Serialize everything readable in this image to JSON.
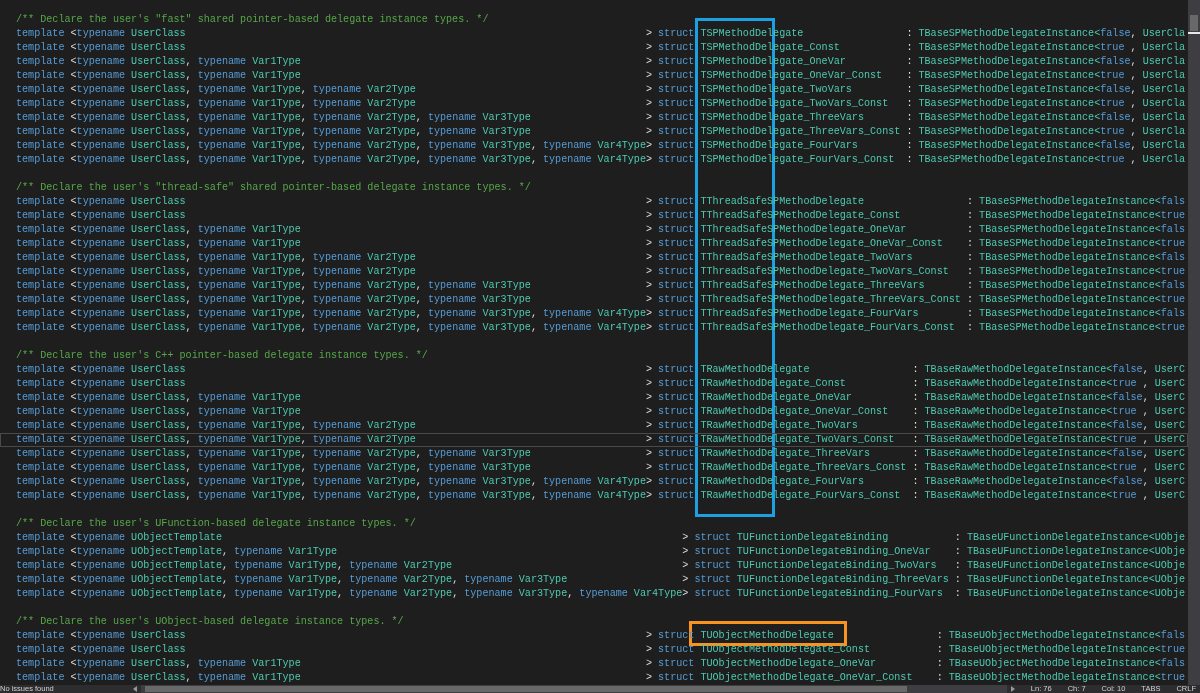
{
  "editor": {
    "sections": [
      {
        "comment": "/** Declare the user's \"fast\" shared pointer-based delegate instance types. */",
        "lines": [
          {
            "current": false,
            "keyword": "template",
            "params": [
              {
                "punct": "<",
                "keyword": "typename",
                "type": "UserClass"
              }
            ],
            "close": ">",
            "struct": "struct",
            "name": "TSPMethodDelegate",
            "colon": ":",
            "base": "TBaseSPMethodDelegateInstance<",
            "flag": "false",
            "comma": ",",
            "rest": "UserCla"
          },
          {
            "current": false,
            "keyword": "template",
            "params": [
              {
                "punct": "<",
                "keyword": "typename",
                "type": "UserClass"
              }
            ],
            "close": ">",
            "struct": "struct",
            "name": "TSPMethodDelegate_Const",
            "colon": ":",
            "base": "TBaseSPMethodDelegateInstance<",
            "flag": "true",
            "comma": ",",
            "rest": "UserCla"
          },
          {
            "current": false,
            "keyword": "template",
            "params": [
              {
                "punct": "<",
                "keyword": "typename",
                "type": "UserClass"
              },
              {
                "punct": ",",
                "keyword": "typename",
                "type": "Var1Type"
              }
            ],
            "close": ">",
            "struct": "struct",
            "name": "TSPMethodDelegate_OneVar",
            "colon": ":",
            "base": "TBaseSPMethodDelegateInstance<",
            "flag": "false",
            "comma": ",",
            "rest": "UserCla"
          },
          {
            "current": false,
            "keyword": "template",
            "params": [
              {
                "punct": "<",
                "keyword": "typename",
                "type": "UserClass"
              },
              {
                "punct": ",",
                "keyword": "typename",
                "type": "Var1Type"
              }
            ],
            "close": ">",
            "struct": "struct",
            "name": "TSPMethodDelegate_OneVar_Const",
            "colon": ":",
            "base": "TBaseSPMethodDelegateInstance<",
            "flag": "true",
            "comma": ",",
            "rest": "UserCla"
          },
          {
            "current": false,
            "keyword": "template",
            "params": [
              {
                "punct": "<",
                "keyword": "typename",
                "type": "UserClass"
              },
              {
                "punct": ",",
                "keyword": "typename",
                "type": "Var1Type"
              },
              {
                "punct": ",",
                "keyword": "typename",
                "type": "Var2Type"
              }
            ],
            "close": ">",
            "struct": "struct",
            "name": "TSPMethodDelegate_TwoVars",
            "colon": ":",
            "base": "TBaseSPMethodDelegateInstance<",
            "flag": "false",
            "comma": ",",
            "rest": "UserCla"
          },
          {
            "current": false,
            "keyword": "template",
            "params": [
              {
                "punct": "<",
                "keyword": "typename",
                "type": "UserClass"
              },
              {
                "punct": ",",
                "keyword": "typename",
                "type": "Var1Type"
              },
              {
                "punct": ",",
                "keyword": "typename",
                "type": "Var2Type"
              }
            ],
            "close": ">",
            "struct": "struct",
            "name": "TSPMethodDelegate_TwoVars_Const",
            "colon": ":",
            "base": "TBaseSPMethodDelegateInstance<",
            "flag": "true",
            "comma": ",",
            "rest": "UserCla"
          },
          {
            "current": false,
            "keyword": "template",
            "params": [
              {
                "punct": "<",
                "keyword": "typename",
                "type": "UserClass"
              },
              {
                "punct": ",",
                "keyword": "typename",
                "type": "Var1Type"
              },
              {
                "punct": ",",
                "keyword": "typename",
                "type": "Var2Type"
              },
              {
                "punct": ",",
                "keyword": "typename",
                "type": "Var3Type"
              }
            ],
            "close": ">",
            "struct": "struct",
            "name": "TSPMethodDelegate_ThreeVars",
            "colon": ":",
            "base": "TBaseSPMethodDelegateInstance<",
            "flag": "false",
            "comma": ",",
            "rest": "UserCla"
          },
          {
            "current": false,
            "keyword": "template",
            "params": [
              {
                "punct": "<",
                "keyword": "typename",
                "type": "UserClass"
              },
              {
                "punct": ",",
                "keyword": "typename",
                "type": "Var1Type"
              },
              {
                "punct": ",",
                "keyword": "typename",
                "type": "Var2Type"
              },
              {
                "punct": ",",
                "keyword": "typename",
                "type": "Var3Type"
              }
            ],
            "close": ">",
            "struct": "struct",
            "name": "TSPMethodDelegate_ThreeVars_Const",
            "colon": ":",
            "base": "TBaseSPMethodDelegateInstance<",
            "flag": "true",
            "comma": ",",
            "rest": "UserCla"
          },
          {
            "current": false,
            "keyword": "template",
            "params": [
              {
                "punct": "<",
                "keyword": "typename",
                "type": "UserClass"
              },
              {
                "punct": ",",
                "keyword": "typename",
                "type": "Var1Type"
              },
              {
                "punct": ",",
                "keyword": "typename",
                "type": "Var2Type"
              },
              {
                "punct": ",",
                "keyword": "typename",
                "type": "Var3Type"
              },
              {
                "punct": ",",
                "keyword": "typename",
                "type": "Var4Type"
              }
            ],
            "close": ">",
            "struct": "struct",
            "name": "TSPMethodDelegate_FourVars",
            "colon": ":",
            "base": "TBaseSPMethodDelegateInstance<",
            "flag": "false",
            "comma": ",",
            "rest": "UserCla"
          },
          {
            "current": false,
            "keyword": "template",
            "params": [
              {
                "punct": "<",
                "keyword": "typename",
                "type": "UserClass"
              },
              {
                "punct": ",",
                "keyword": "typename",
                "type": "Var1Type"
              },
              {
                "punct": ",",
                "keyword": "typename",
                "type": "Var2Type"
              },
              {
                "punct": ",",
                "keyword": "typename",
                "type": "Var3Type"
              },
              {
                "punct": ",",
                "keyword": "typename",
                "type": "Var4Type"
              }
            ],
            "close": ">",
            "struct": "struct",
            "name": "TSPMethodDelegate_FourVars_Const",
            "colon": ":",
            "base": "TBaseSPMethodDelegateInstance<",
            "flag": "true",
            "comma": ",",
            "rest": "UserCla"
          }
        ]
      },
      {
        "comment": "/** Declare the user's \"thread-safe\" shared pointer-based delegate instance types. */",
        "lines": [
          {
            "current": false,
            "keyword": "template",
            "params": [
              {
                "punct": "<",
                "keyword": "typename",
                "type": "UserClass"
              }
            ],
            "close": ">",
            "struct": "struct",
            "name": "TThreadSafeSPMethodDelegate",
            "colon": ":",
            "base": "TBaseSPMethodDelegateInstance<",
            "flag": "fals"
          },
          {
            "current": false,
            "keyword": "template",
            "params": [
              {
                "punct": "<",
                "keyword": "typename",
                "type": "UserClass"
              }
            ],
            "close": ">",
            "struct": "struct",
            "name": "TThreadSafeSPMethodDelegate_Const",
            "colon": ":",
            "base": "TBaseSPMethodDelegateInstance<",
            "flag": "true"
          },
          {
            "current": false,
            "keyword": "template",
            "params": [
              {
                "punct": "<",
                "keyword": "typename",
                "type": "UserClass"
              },
              {
                "punct": ",",
                "keyword": "typename",
                "type": "Var1Type"
              }
            ],
            "close": ">",
            "struct": "struct",
            "name": "TThreadSafeSPMethodDelegate_OneVar",
            "colon": ":",
            "base": "TBaseSPMethodDelegateInstance<",
            "flag": "fals"
          },
          {
            "current": false,
            "keyword": "template",
            "params": [
              {
                "punct": "<",
                "keyword": "typename",
                "type": "UserClass"
              },
              {
                "punct": ",",
                "keyword": "typename",
                "type": "Var1Type"
              }
            ],
            "close": ">",
            "struct": "struct",
            "name": "TThreadSafeSPMethodDelegate_OneVar_Const",
            "colon": ":",
            "base": "TBaseSPMethodDelegateInstance<",
            "flag": "true"
          },
          {
            "current": false,
            "keyword": "template",
            "params": [
              {
                "punct": "<",
                "keyword": "typename",
                "type": "UserClass"
              },
              {
                "punct": ",",
                "keyword": "typename",
                "type": "Var1Type"
              },
              {
                "punct": ",",
                "keyword": "typename",
                "type": "Var2Type"
              }
            ],
            "close": ">",
            "struct": "struct",
            "name": "TThreadSafeSPMethodDelegate_TwoVars",
            "colon": ":",
            "base": "TBaseSPMethodDelegateInstance<",
            "flag": "fals"
          },
          {
            "current": false,
            "keyword": "template",
            "params": [
              {
                "punct": "<",
                "keyword": "typename",
                "type": "UserClass"
              },
              {
                "punct": ",",
                "keyword": "typename",
                "type": "Var1Type"
              },
              {
                "punct": ",",
                "keyword": "typename",
                "type": "Var2Type"
              }
            ],
            "close": ">",
            "struct": "struct",
            "name": "TThreadSafeSPMethodDelegate_TwoVars_Const",
            "colon": ":",
            "base": "TBaseSPMethodDelegateInstance<",
            "flag": "true"
          },
          {
            "current": false,
            "keyword": "template",
            "params": [
              {
                "punct": "<",
                "keyword": "typename",
                "type": "UserClass"
              },
              {
                "punct": ",",
                "keyword": "typename",
                "type": "Var1Type"
              },
              {
                "punct": ",",
                "keyword": "typename",
                "type": "Var2Type"
              },
              {
                "punct": ",",
                "keyword": "typename",
                "type": "Var3Type"
              }
            ],
            "close": ">",
            "struct": "struct",
            "name": "TThreadSafeSPMethodDelegate_ThreeVars",
            "colon": ":",
            "base": "TBaseSPMethodDelegateInstance<",
            "flag": "fals"
          },
          {
            "current": false,
            "keyword": "template",
            "params": [
              {
                "punct": "<",
                "keyword": "typename",
                "type": "UserClass"
              },
              {
                "punct": ",",
                "keyword": "typename",
                "type": "Var1Type"
              },
              {
                "punct": ",",
                "keyword": "typename",
                "type": "Var2Type"
              },
              {
                "punct": ",",
                "keyword": "typename",
                "type": "Var3Type"
              }
            ],
            "close": ">",
            "struct": "struct",
            "name": "TThreadSafeSPMethodDelegate_ThreeVars_Const",
            "colon": ":",
            "base": "TBaseSPMethodDelegateInstance<",
            "flag": "true"
          },
          {
            "current": false,
            "keyword": "template",
            "params": [
              {
                "punct": "<",
                "keyword": "typename",
                "type": "UserClass"
              },
              {
                "punct": ",",
                "keyword": "typename",
                "type": "Var1Type"
              },
              {
                "punct": ",",
                "keyword": "typename",
                "type": "Var2Type"
              },
              {
                "punct": ",",
                "keyword": "typename",
                "type": "Var3Type"
              },
              {
                "punct": ",",
                "keyword": "typename",
                "type": "Var4Type"
              }
            ],
            "close": ">",
            "struct": "struct",
            "name": "TThreadSafeSPMethodDelegate_FourVars",
            "colon": ":",
            "base": "TBaseSPMethodDelegateInstance<",
            "flag": "fals"
          },
          {
            "current": false,
            "keyword": "template",
            "params": [
              {
                "punct": "<",
                "keyword": "typename",
                "type": "UserClass"
              },
              {
                "punct": ",",
                "keyword": "typename",
                "type": "Var1Type"
              },
              {
                "punct": ",",
                "keyword": "typename",
                "type": "Var2Type"
              },
              {
                "punct": ",",
                "keyword": "typename",
                "type": "Var3Type"
              },
              {
                "punct": ",",
                "keyword": "typename",
                "type": "Var4Type"
              }
            ],
            "close": ">",
            "struct": "struct",
            "name": "TThreadSafeSPMethodDelegate_FourVars_Const",
            "colon": ":",
            "base": "TBaseSPMethodDelegateInstance<",
            "flag": "true"
          }
        ]
      },
      {
        "comment": "/** Declare the user's C++ pointer-based delegate instance types. */",
        "lines": [
          {
            "current": false,
            "keyword": "template",
            "params": [
              {
                "punct": "<",
                "keyword": "typename",
                "type": "UserClass"
              }
            ],
            "close": ">",
            "struct": "struct",
            "name": "TRawMethodDelegate",
            "colon": ":",
            "base": "TBaseRawMethodDelegateInstance<",
            "flag": "false",
            "comma": ",",
            "rest": "UserC"
          },
          {
            "current": false,
            "keyword": "template",
            "params": [
              {
                "punct": "<",
                "keyword": "typename",
                "type": "UserClass"
              }
            ],
            "close": ">",
            "struct": "struct",
            "name": "TRawMethodDelegate_Const",
            "colon": ":",
            "base": "TBaseRawMethodDelegateInstance<",
            "flag": "true",
            "comma": ",",
            "rest": "UserC"
          },
          {
            "current": false,
            "keyword": "template",
            "params": [
              {
                "punct": "<",
                "keyword": "typename",
                "type": "UserClass"
              },
              {
                "punct": ",",
                "keyword": "typename",
                "type": "Var1Type"
              }
            ],
            "close": ">",
            "struct": "struct",
            "name": "TRawMethodDelegate_OneVar",
            "colon": ":",
            "base": "TBaseRawMethodDelegateInstance<",
            "flag": "false",
            "comma": ",",
            "rest": "UserC"
          },
          {
            "current": false,
            "keyword": "template",
            "params": [
              {
                "punct": "<",
                "keyword": "typename",
                "type": "UserClass"
              },
              {
                "punct": ",",
                "keyword": "typename",
                "type": "Var1Type"
              }
            ],
            "close": ">",
            "struct": "struct",
            "name": "TRawMethodDelegate_OneVar_Const",
            "colon": ":",
            "base": "TBaseRawMethodDelegateInstance<",
            "flag": "true",
            "comma": ",",
            "rest": "UserC"
          },
          {
            "current": false,
            "keyword": "template",
            "params": [
              {
                "punct": "<",
                "keyword": "typename",
                "type": "UserClass"
              },
              {
                "punct": ",",
                "keyword": "typename",
                "type": "Var1Type"
              },
              {
                "punct": ",",
                "keyword": "typename",
                "type": "Var2Type"
              }
            ],
            "close": ">",
            "struct": "struct",
            "name": "TRawMethodDelegate_TwoVars",
            "colon": ":",
            "base": "TBaseRawMethodDelegateInstance<",
            "flag": "false",
            "comma": ",",
            "rest": "UserC"
          },
          {
            "current": true,
            "keyword": "template",
            "params": [
              {
                "punct": "<",
                "keyword": "typename",
                "type": "UserClass"
              },
              {
                "punct": ",",
                "keyword": "typename",
                "type": "Var1Type"
              },
              {
                "punct": ",",
                "keyword": "typename",
                "type": "Var2Type"
              }
            ],
            "close": ">",
            "struct": "struct",
            "name": "TRawMethodDelegate_TwoVars_Const",
            "colon": ":",
            "base": "TBaseRawMethodDelegateInstance<",
            "flag": "true",
            "comma": ",",
            "rest": "UserC"
          },
          {
            "current": false,
            "keyword": "template",
            "params": [
              {
                "punct": "<",
                "keyword": "typename",
                "type": "UserClass"
              },
              {
                "punct": ",",
                "keyword": "typename",
                "type": "Var1Type"
              },
              {
                "punct": ",",
                "keyword": "typename",
                "type": "Var2Type"
              },
              {
                "punct": ",",
                "keyword": "typename",
                "type": "Var3Type"
              }
            ],
            "close": ">",
            "struct": "struct",
            "name": "TRawMethodDelegate_ThreeVars",
            "colon": ":",
            "base": "TBaseRawMethodDelegateInstance<",
            "flag": "false",
            "comma": ",",
            "rest": "UserC"
          },
          {
            "current": false,
            "keyword": "template",
            "params": [
              {
                "punct": "<",
                "keyword": "typename",
                "type": "UserClass"
              },
              {
                "punct": ",",
                "keyword": "typename",
                "type": "Var1Type"
              },
              {
                "punct": ",",
                "keyword": "typename",
                "type": "Var2Type"
              },
              {
                "punct": ",",
                "keyword": "typename",
                "type": "Var3Type"
              }
            ],
            "close": ">",
            "struct": "struct",
            "name": "TRawMethodDelegate_ThreeVars_Const",
            "colon": ":",
            "base": "TBaseRawMethodDelegateInstance<",
            "flag": "true",
            "comma": ",",
            "rest": "UserC"
          },
          {
            "current": false,
            "keyword": "template",
            "params": [
              {
                "punct": "<",
                "keyword": "typename",
                "type": "UserClass"
              },
              {
                "punct": ",",
                "keyword": "typename",
                "type": "Var1Type"
              },
              {
                "punct": ",",
                "keyword": "typename",
                "type": "Var2Type"
              },
              {
                "punct": ",",
                "keyword": "typename",
                "type": "Var3Type"
              },
              {
                "punct": ",",
                "keyword": "typename",
                "type": "Var4Type"
              }
            ],
            "close": ">",
            "struct": "struct",
            "name": "TRawMethodDelegate_FourVars",
            "colon": ":",
            "base": "TBaseRawMethodDelegateInstance<",
            "flag": "false",
            "comma": ",",
            "rest": "UserC"
          },
          {
            "current": false,
            "keyword": "template",
            "params": [
              {
                "punct": "<",
                "keyword": "typename",
                "type": "UserClass"
              },
              {
                "punct": ",",
                "keyword": "typename",
                "type": "Var1Type"
              },
              {
                "punct": ",",
                "keyword": "typename",
                "type": "Var2Type"
              },
              {
                "punct": ",",
                "keyword": "typename",
                "type": "Var3Type"
              },
              {
                "punct": ",",
                "keyword": "typename",
                "type": "Var4Type"
              }
            ],
            "close": ">",
            "struct": "struct",
            "name": "TRawMethodDelegate_FourVars_Const",
            "colon": ":",
            "base": "TBaseRawMethodDelegateInstance<",
            "flag": "true",
            "comma": ",",
            "rest": "UserC"
          }
        ]
      },
      {
        "comment": "/** Declare the user's UFunction-based delegate instance types. */",
        "lines": [
          {
            "current": false,
            "keyword": "template",
            "params": [
              {
                "punct": "<",
                "keyword": "typename",
                "type": "UObjectTemplate"
              }
            ],
            "close": ">",
            "struct": "struct",
            "name": "TUFunctionDelegateBinding",
            "colon": ":",
            "base": "TBaseUFunctionDelegateInstance<UObje"
          },
          {
            "current": false,
            "keyword": "template",
            "params": [
              {
                "punct": "<",
                "keyword": "typename",
                "type": "UObjectTemplate"
              },
              {
                "punct": ",",
                "keyword": "typename",
                "type": "Var1Type"
              }
            ],
            "close": ">",
            "struct": "struct",
            "name": "TUFunctionDelegateBinding_OneVar",
            "colon": ":",
            "base": "TBaseUFunctionDelegateInstance<UObje"
          },
          {
            "current": false,
            "keyword": "template",
            "params": [
              {
                "punct": "<",
                "keyword": "typename",
                "type": "UObjectTemplate"
              },
              {
                "punct": ",",
                "keyword": "typename",
                "type": "Var1Type"
              },
              {
                "punct": ",",
                "keyword": "typename",
                "type": "Var2Type"
              }
            ],
            "close": ">",
            "struct": "struct",
            "name": "TUFunctionDelegateBinding_TwoVars",
            "colon": ":",
            "base": "TBaseUFunctionDelegateInstance<UObje"
          },
          {
            "current": false,
            "keyword": "template",
            "params": [
              {
                "punct": "<",
                "keyword": "typename",
                "type": "UObjectTemplate"
              },
              {
                "punct": ",",
                "keyword": "typename",
                "type": "Var1Type"
              },
              {
                "punct": ",",
                "keyword": "typename",
                "type": "Var2Type"
              },
              {
                "punct": ",",
                "keyword": "typename",
                "type": "Var3Type"
              }
            ],
            "close": ">",
            "struct": "struct",
            "name": "TUFunctionDelegateBinding_ThreeVars",
            "colon": ":",
            "base": "TBaseUFunctionDelegateInstance<UObje"
          },
          {
            "current": false,
            "keyword": "template",
            "params": [
              {
                "punct": "<",
                "keyword": "typename",
                "type": "UObjectTemplate"
              },
              {
                "punct": ",",
                "keyword": "typename",
                "type": "Var1Type"
              },
              {
                "punct": ",",
                "keyword": "typename",
                "type": "Var2Type"
              },
              {
                "punct": ",",
                "keyword": "typename",
                "type": "Var3Type"
              },
              {
                "punct": ",",
                "keyword": "typename",
                "type": "Var4Type"
              }
            ],
            "close": ">",
            "struct": "struct",
            "name": "TUFunctionDelegateBinding_FourVars",
            "colon": ":",
            "base": "TBaseUFunctionDelegateInstance<UObje"
          }
        ]
      },
      {
        "comment": "/** Declare the user's UObject-based delegate instance types. */",
        "lines": [
          {
            "current": false,
            "keyword": "template",
            "params": [
              {
                "punct": "<",
                "keyword": "typename",
                "type": "UserClass"
              }
            ],
            "close": ">",
            "struct": "struct",
            "name": "TUObjectMethodDelegate",
            "colon": ":",
            "base": "TBaseUObjectMethodDelegateInstance<",
            "flag": "fals"
          },
          {
            "current": false,
            "keyword": "template",
            "params": [
              {
                "punct": "<",
                "keyword": "typename",
                "type": "UserClass"
              }
            ],
            "close": ">",
            "struct": "struct",
            "name": "TUObjectMethodDelegate_Const",
            "colon": ":",
            "base": "TBaseUObjectMethodDelegateInstance<",
            "flag": "true"
          },
          {
            "current": false,
            "keyword": "template",
            "params": [
              {
                "punct": "<",
                "keyword": "typename",
                "type": "UserClass"
              },
              {
                "punct": ",",
                "keyword": "typename",
                "type": "Var1Type"
              }
            ],
            "close": ">",
            "struct": "struct",
            "name": "TUObjectMethodDelegate_OneVar",
            "colon": ":",
            "base": "TBaseUObjectMethodDelegateInstance<",
            "flag": "fals"
          },
          {
            "current": false,
            "keyword": "template",
            "params": [
              {
                "punct": "<",
                "keyword": "typename",
                "type": "UserClass"
              },
              {
                "punct": ",",
                "keyword": "typename",
                "type": "Var1Type"
              }
            ],
            "close": ">",
            "struct": "struct",
            "name": "TUObjectMethodDelegate_OneVar_Const",
            "colon": ":",
            "base": "TBaseUObjectMethodDelegateInstance<",
            "flag": "true"
          }
        ]
      }
    ]
  },
  "annotations": [
    {
      "color": "#1ba1e2"
    },
    {
      "color": "#f7931e"
    }
  ],
  "status_bar": {
    "message": "No issues found",
    "line": "Ln: 76",
    "char": "Ch: 7",
    "column": "Col: 10",
    "indent": "TABS",
    "line_ending": "CRLF"
  }
}
